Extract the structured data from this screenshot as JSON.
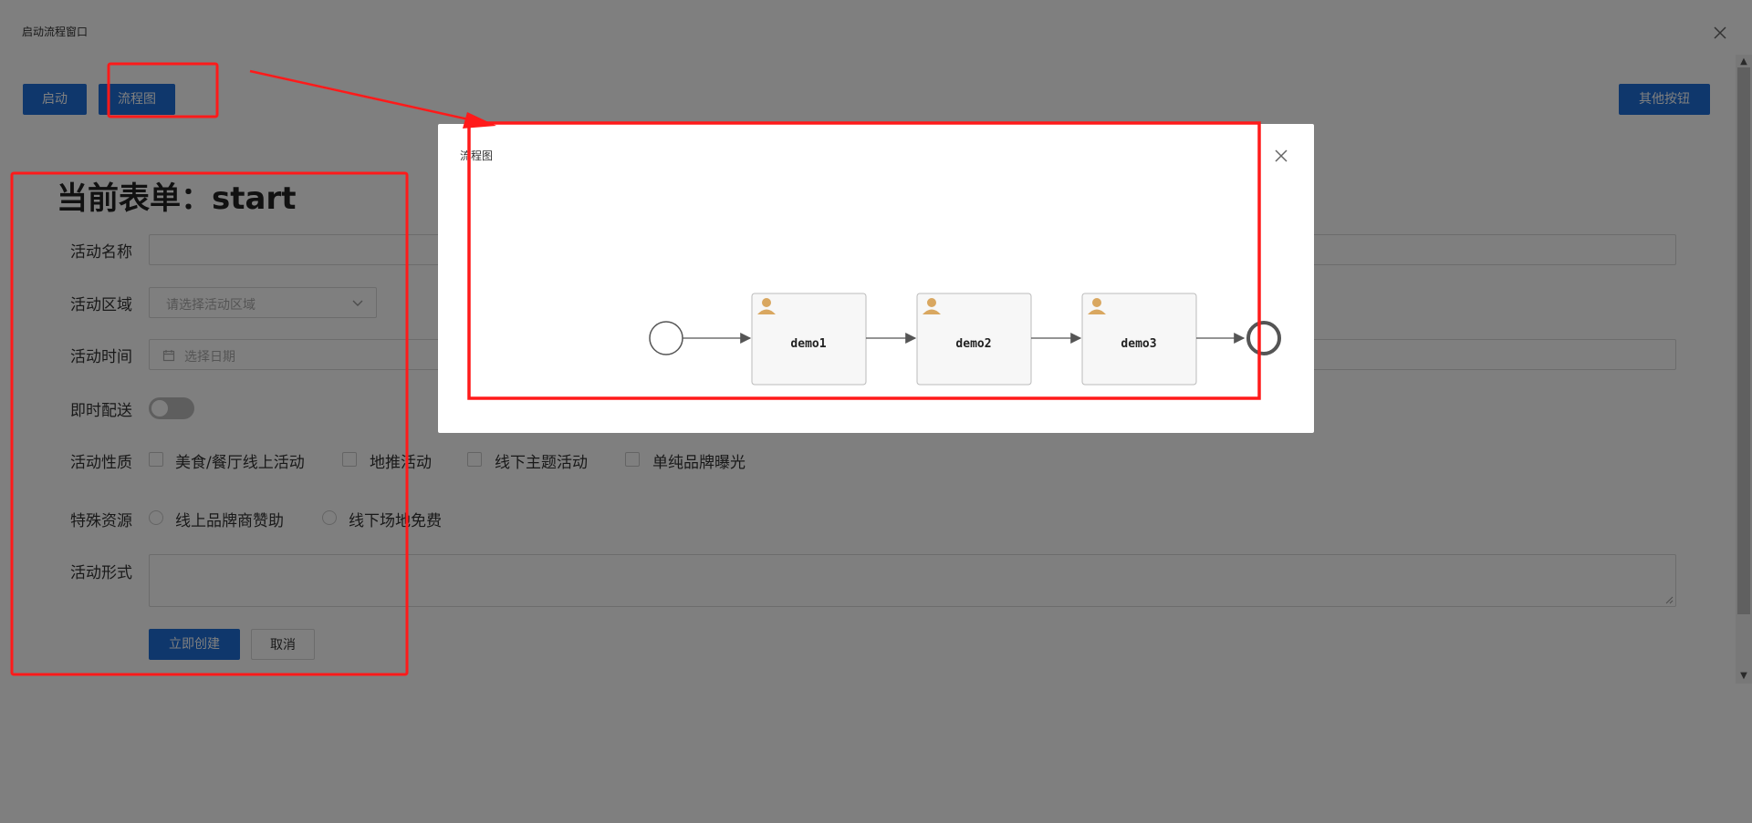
{
  "window": {
    "title": "启动流程窗口"
  },
  "toolbar": {
    "start_label": "启动",
    "flowchart_label": "流程图",
    "other_label": "其他按钮"
  },
  "form": {
    "title": "当前表单：start",
    "name_label": "活动名称",
    "region_label": "活动区域",
    "region_placeholder": "请选择活动区域",
    "time_label": "活动时间",
    "date_placeholder": "选择日期",
    "delivery_label": "即时配送",
    "nature_label": "活动性质",
    "nature_options": [
      "美食/餐厅线上活动",
      "地推活动",
      "线下主题活动",
      "单纯品牌曝光"
    ],
    "resource_label": "特殊资源",
    "resource_options": [
      "线上品牌商赞助",
      "线下场地免费"
    ],
    "form_label": "活动形式",
    "create_label": "立即创建",
    "cancel_label": "取消"
  },
  "modal": {
    "title": "流程图",
    "tasks": [
      "demo1",
      "demo2",
      "demo3"
    ]
  },
  "colors": {
    "primary": "#1e6fd9",
    "annotation": "#ff1a1a",
    "user_icon": "#d9a760"
  }
}
